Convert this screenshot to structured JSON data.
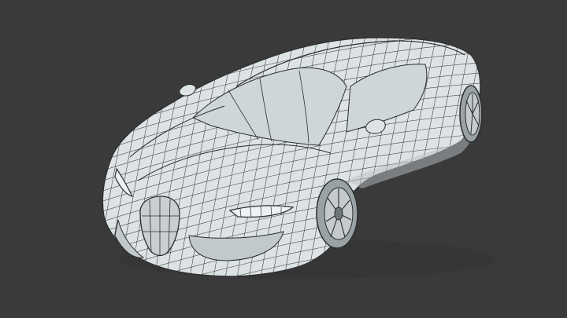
{
  "scene": {
    "subject": "car-wireframe-render",
    "colors": {
      "background": "#3a3a3a",
      "body_fill": "#dde2e4",
      "body_shadow": "#b9c0c3",
      "mesh_lines": "#2a2d2f",
      "wheel_fill": "#9aa2a6",
      "glass_fill": "#cfd6d9"
    }
  }
}
